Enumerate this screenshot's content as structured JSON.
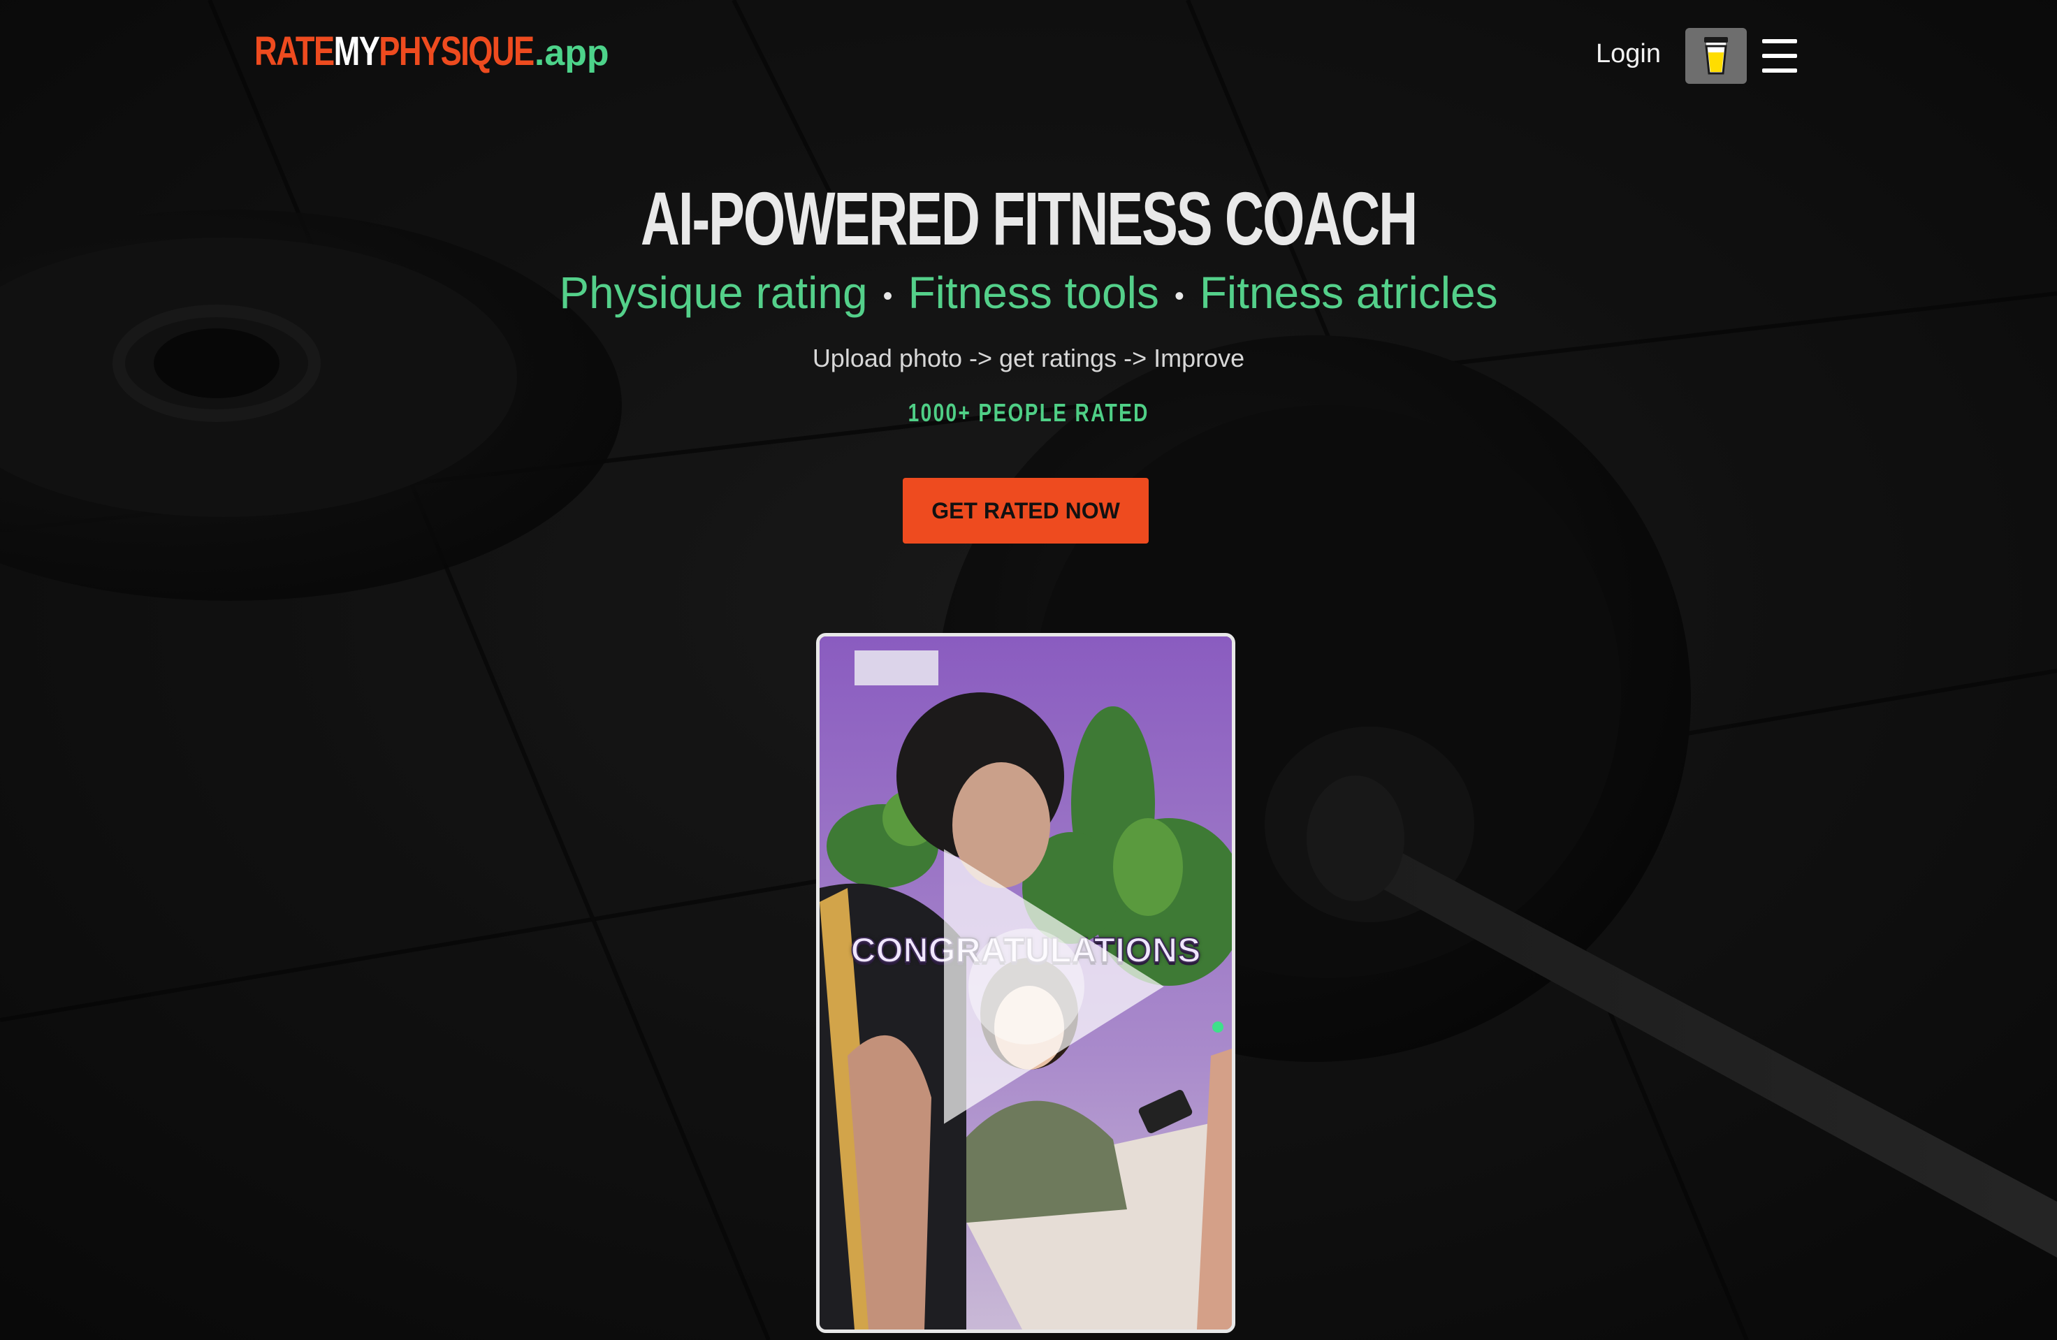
{
  "header": {
    "logo": {
      "rate": "RATE",
      "my": "MY",
      "physique": "PHYSIQUE",
      "app": ".app"
    },
    "login_label": "Login",
    "coffee_icon": "coffee-cup-icon",
    "menu_icon": "hamburger-menu-icon"
  },
  "hero": {
    "title": "AI-POWERED FITNESS COACH",
    "features": [
      "Physique rating",
      "Fitness tools",
      "Fitness atricles"
    ],
    "separator": "•",
    "tagline": "Upload photo -> get ratings -> Improve",
    "rated_count": "1000+ PEOPLE RATED",
    "cta_label": "GET RATED NOW"
  },
  "video": {
    "overlay_text": "CONGRATULATIONS",
    "play_icon": "play-icon"
  },
  "colors": {
    "brand_orange": "#ee4b1f",
    "brand_green": "#4fcf86",
    "background": "#161616"
  }
}
